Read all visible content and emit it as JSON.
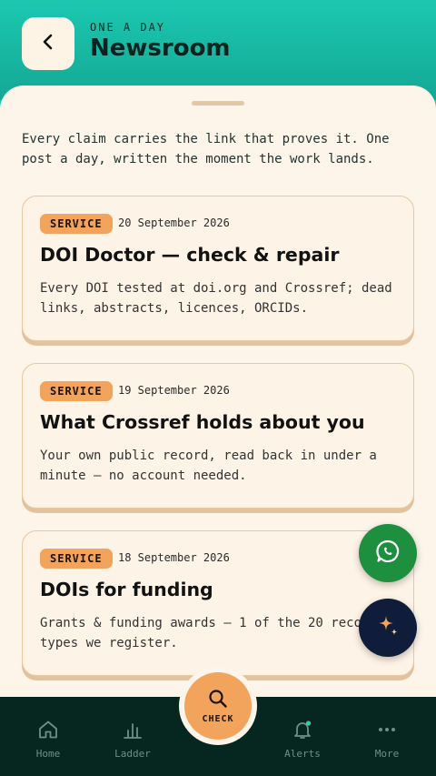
{
  "header": {
    "eyebrow": "ONE A DAY",
    "title": "Newsroom",
    "back_icon": "chevron-left-icon"
  },
  "intro": "Every claim carries the link that proves it. One post a day, written the moment the work lands.",
  "posts": [
    {
      "badge": "SERVICE",
      "date": "20 September 2026",
      "title": "DOI Doctor — check & repair",
      "description": "Every DOI tested at doi.org and Crossref; dead links, abstracts, licences, ORCIDs."
    },
    {
      "badge": "SERVICE",
      "date": "19 September 2026",
      "title": "What Crossref holds about you",
      "description": "Your own public record, read back in under a minute — no account needed."
    },
    {
      "badge": "SERVICE",
      "date": "18 September 2026",
      "title": "DOIs for funding",
      "description": "Grants & funding awards — 1 of the 20 record types we register."
    }
  ],
  "fabs": {
    "whatsapp_icon": "whatsapp-icon",
    "ai_icon": "sparkle-icon"
  },
  "nav": {
    "items": [
      {
        "label": "Home",
        "icon": "home-icon"
      },
      {
        "label": "Ladder",
        "icon": "bar-chart-icon"
      },
      {
        "label": "Alerts",
        "icon": "bell-icon"
      },
      {
        "label": "More",
        "icon": "more-dots-icon"
      }
    ],
    "check_label": "CHECK",
    "check_icon": "search-icon"
  },
  "colors": {
    "header_teal": "#17c4ae",
    "sheet_cream": "#fdf5ea",
    "badge_orange": "#f2a45c",
    "nav_dark": "#062620",
    "whatsapp_green": "#1e8f3f",
    "ai_navy": "#0f1d3a"
  }
}
